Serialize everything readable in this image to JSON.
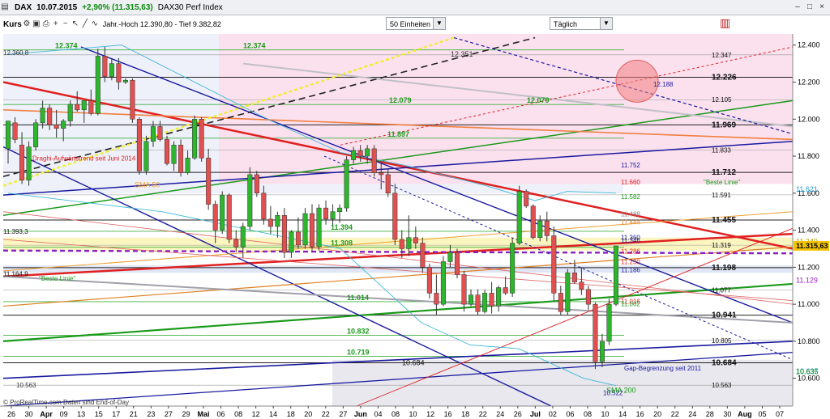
{
  "header": {
    "symbol": "DAX",
    "date": "10.07.2015",
    "change": "+2,90% (11.315,63)",
    "index_name": "DAX30 Perf Index"
  },
  "toolbar": {
    "kurs_label": "Kurs",
    "info": "Jahr.-Hoch 12.390,80 - Tief 9.382,82",
    "units_select": "50 Einheiten",
    "period_select": "Täglich"
  },
  "footer": {
    "credit": "© ProRealTime.com  Daten sind End-of-Day"
  },
  "icons": [
    "gear-icon",
    "save-icon",
    "print-icon",
    "zoom-in-icon",
    "zoom-out-icon",
    "cursor-icon",
    "line-tool-icon",
    "indicator-icon"
  ],
  "colors": {
    "up": "#2db52d",
    "down": "#e05050",
    "support": "#1a1aa0",
    "resistance": "#e02020"
  },
  "chart_data": {
    "type": "candlestick",
    "title": "DAX30 Perf Index",
    "ylim": [
      10450,
      12460
    ],
    "x_ticks": [
      "26",
      "30",
      "Apr",
      "09",
      "13",
      "15",
      "17",
      "21",
      "23",
      "27",
      "29",
      "Mai",
      "06",
      "08",
      "12",
      "14",
      "18",
      "20",
      "22",
      "27",
      "Jun",
      "04",
      "08",
      "10",
      "12",
      "16",
      "18",
      "22",
      "24",
      "26",
      "Jul",
      "02",
      "06",
      "08",
      "10",
      "14",
      "16",
      "20",
      "22",
      "24",
      "28",
      "30",
      "Aug",
      "05",
      "07"
    ],
    "y_ticks": [
      "12.400",
      "12.200",
      "12.000",
      "11.800",
      "11.600",
      "11.400",
      "11.200",
      "11.000",
      "10.800",
      "10.600"
    ],
    "price_labels_right": [
      {
        "text": "12.347",
        "value": 12347,
        "bold": false
      },
      {
        "text": "12.226",
        "value": 12226,
        "bold": true
      },
      {
        "text": "12.105",
        "value": 12105,
        "bold": false
      },
      {
        "text": "11.969",
        "value": 11969,
        "bold": true
      },
      {
        "text": "11.833",
        "value": 11833,
        "bold": false
      },
      {
        "text": "11.712",
        "value": 11712,
        "bold": true
      },
      {
        "text": "11.591",
        "value": 11591,
        "bold": false
      },
      {
        "text": "11.455",
        "value": 11455,
        "bold": true
      },
      {
        "text": "11.319",
        "value": 11319,
        "bold": false
      },
      {
        "text": "11.198",
        "value": 11198,
        "bold": true
      },
      {
        "text": "11.077",
        "value": 11077,
        "bold": false
      },
      {
        "text": "10.941",
        "value": 10941,
        "bold": true
      },
      {
        "text": "10.805",
        "value": 10805,
        "bold": false
      },
      {
        "text": "10.684",
        "value": 10684,
        "bold": true
      },
      {
        "text": "10.563",
        "value": 10563,
        "bold": false
      }
    ],
    "axis_badges": [
      {
        "text": "11.621",
        "value": 11621,
        "color": "#1a9ad8"
      },
      {
        "text": "11.340",
        "value": 11340,
        "color": "#b8a000"
      },
      {
        "text": "11.315,63",
        "value": 11315.63,
        "color": "#000000",
        "bg": "#f5c400"
      },
      {
        "text": "11.129",
        "value": 11129,
        "color": "#9a20c0"
      },
      {
        "text": "10.637",
        "value": 10637,
        "color": "#1a9ad8"
      },
      {
        "text": "10.635",
        "value": 10635,
        "color": "#0a8a0a"
      }
    ],
    "green_labels": [
      {
        "text": "12.374",
        "value": 12374,
        "pos": "left"
      },
      {
        "text": "12.374",
        "value": 12374,
        "pos": "mid"
      },
      {
        "text": "12.079",
        "value": 12079,
        "pos": "mid2"
      },
      {
        "text": "12.079",
        "value": 12079,
        "pos": "right"
      },
      {
        "text": "11.897",
        "value": 11897,
        "pos": "mid3"
      },
      {
        "text": "11.394",
        "value": 11394,
        "pos": "mid4"
      },
      {
        "text": "11.308",
        "value": 11308,
        "pos": "mid4"
      },
      {
        "text": "11.014",
        "value": 11014,
        "pos": "mid5"
      },
      {
        "text": "10.832",
        "value": 10832,
        "pos": "mid6"
      },
      {
        "text": "10.719",
        "value": 10719,
        "pos": "mid6"
      }
    ],
    "annotations": [
      {
        "text": "12.351",
        "value": 12351
      },
      {
        "text": "12.360,8",
        "value": 12360
      },
      {
        "text": "11.393,3",
        "value": 11393
      },
      {
        "text": "11.164,9",
        "value": 11164
      },
      {
        "text": "10.684",
        "value": 10684
      },
      {
        "text": "10.563",
        "value": 10563
      },
      {
        "text": "12.188",
        "value": 12188
      },
      {
        "text": "11.752",
        "value": 11752
      },
      {
        "text": "11.360",
        "value": 11360
      },
      {
        "text": "11.346",
        "value": 11346
      },
      {
        "text": "11.286",
        "value": 11286
      },
      {
        "text": "11.230",
        "value": 11230
      },
      {
        "text": "11.186",
        "value": 11186
      },
      {
        "text": "11.016",
        "value": 11016
      },
      {
        "text": "11.002",
        "value": 11002
      },
      {
        "text": "10.522",
        "value": 10522
      },
      {
        "text": "11.660",
        "value": 11660
      },
      {
        "text": "11.582",
        "value": 11582
      },
      {
        "text": "11.488",
        "value": 11488
      },
      {
        "text": "11.444",
        "value": 11444
      },
      {
        "text": "Draghi-Aufwärtstrend seit Juni 2014",
        "value": 11790
      },
      {
        "text": "SMA 50",
        "value": 11645
      },
      {
        "text": "\"Beste Linie\"",
        "value": 11140
      },
      {
        "text": "\"Beste Linie\"",
        "value": 11660
      },
      {
        "text": "Gap-Begrenzung seit 2011",
        "value": 10655
      },
      {
        "text": "SMA 200",
        "value": 10535
      }
    ],
    "candles": [
      {
        "o": 11840,
        "h": 11920,
        "l": 11760,
        "c": 11990
      },
      {
        "o": 11980,
        "h": 12010,
        "l": 11870,
        "c": 11890
      },
      {
        "o": 11860,
        "h": 11930,
        "l": 11650,
        "c": 11670
      },
      {
        "o": 11670,
        "h": 11880,
        "l": 11640,
        "c": 11850
      },
      {
        "o": 11850,
        "h": 12000,
        "l": 11830,
        "c": 11980
      },
      {
        "o": 11980,
        "h": 12100,
        "l": 11950,
        "c": 12060
      },
      {
        "o": 12060,
        "h": 12080,
        "l": 11940,
        "c": 11970
      },
      {
        "o": 11970,
        "h": 12050,
        "l": 11900,
        "c": 11950
      },
      {
        "o": 11950,
        "h": 12000,
        "l": 11880,
        "c": 11990
      },
      {
        "o": 11990,
        "h": 12100,
        "l": 11960,
        "c": 12080
      },
      {
        "o": 12080,
        "h": 12150,
        "l": 12040,
        "c": 12050
      },
      {
        "o": 12050,
        "h": 12100,
        "l": 11980,
        "c": 12100
      },
      {
        "o": 12100,
        "h": 12160,
        "l": 12020,
        "c": 12030
      },
      {
        "o": 12030,
        "h": 12380,
        "l": 12020,
        "c": 12340
      },
      {
        "o": 12340,
        "h": 12390,
        "l": 12200,
        "c": 12230
      },
      {
        "o": 12230,
        "h": 12330,
        "l": 12210,
        "c": 12300
      },
      {
        "o": 12300,
        "h": 12330,
        "l": 12160,
        "c": 12200
      },
      {
        "o": 12200,
        "h": 12220,
        "l": 12190,
        "c": 12210
      },
      {
        "o": 12210,
        "h": 12220,
        "l": 11980,
        "c": 12000
      },
      {
        "o": 12000,
        "h": 12010,
        "l": 11700,
        "c": 11720
      },
      {
        "o": 11720,
        "h": 11910,
        "l": 11700,
        "c": 11880
      },
      {
        "o": 11880,
        "h": 11990,
        "l": 11850,
        "c": 11960
      },
      {
        "o": 11960,
        "h": 11990,
        "l": 11880,
        "c": 11890
      },
      {
        "o": 11890,
        "h": 11910,
        "l": 11750,
        "c": 11760
      },
      {
        "o": 11760,
        "h": 11880,
        "l": 11720,
        "c": 11860
      },
      {
        "o": 11860,
        "h": 11890,
        "l": 11690,
        "c": 11710
      },
      {
        "o": 11710,
        "h": 11830,
        "l": 11700,
        "c": 11790
      },
      {
        "o": 11790,
        "h": 12020,
        "l": 11780,
        "c": 12000
      },
      {
        "o": 12000,
        "h": 12010,
        "l": 11770,
        "c": 11790
      },
      {
        "o": 11790,
        "h": 11840,
        "l": 11510,
        "c": 11540
      },
      {
        "o": 11540,
        "h": 11560,
        "l": 11330,
        "c": 11400
      },
      {
        "o": 11400,
        "h": 11610,
        "l": 11380,
        "c": 11590
      },
      {
        "o": 11590,
        "h": 11600,
        "l": 11330,
        "c": 11350
      },
      {
        "o": 11350,
        "h": 11400,
        "l": 11280,
        "c": 11310
      },
      {
        "o": 11310,
        "h": 11440,
        "l": 11250,
        "c": 11420
      },
      {
        "o": 11420,
        "h": 11740,
        "l": 11400,
        "c": 11700
      },
      {
        "o": 11700,
        "h": 11720,
        "l": 11580,
        "c": 11600
      },
      {
        "o": 11600,
        "h": 11640,
        "l": 11430,
        "c": 11460
      },
      {
        "o": 11460,
        "h": 11530,
        "l": 11380,
        "c": 11420
      },
      {
        "o": 11420,
        "h": 11500,
        "l": 11360,
        "c": 11480
      },
      {
        "o": 11480,
        "h": 11520,
        "l": 11250,
        "c": 11280
      },
      {
        "o": 11280,
        "h": 11400,
        "l": 11250,
        "c": 11390
      },
      {
        "o": 11390,
        "h": 11470,
        "l": 11300,
        "c": 11320
      },
      {
        "o": 11320,
        "h": 11520,
        "l": 11300,
        "c": 11490
      },
      {
        "o": 11490,
        "h": 11540,
        "l": 11290,
        "c": 11310
      },
      {
        "o": 11310,
        "h": 11540,
        "l": 11290,
        "c": 11520
      },
      {
        "o": 11520,
        "h": 11560,
        "l": 11430,
        "c": 11460
      },
      {
        "o": 11460,
        "h": 11540,
        "l": 11420,
        "c": 11500
      },
      {
        "o": 11500,
        "h": 11540,
        "l": 11440,
        "c": 11520
      },
      {
        "o": 11520,
        "h": 11800,
        "l": 11500,
        "c": 11780
      },
      {
        "o": 11780,
        "h": 11850,
        "l": 11760,
        "c": 11830
      },
      {
        "o": 11830,
        "h": 11860,
        "l": 11770,
        "c": 11800
      },
      {
        "o": 11800,
        "h": 11860,
        "l": 11760,
        "c": 11840
      },
      {
        "o": 11840,
        "h": 11860,
        "l": 11690,
        "c": 11710
      },
      {
        "o": 11710,
        "h": 11760,
        "l": 11620,
        "c": 11700
      },
      {
        "o": 11700,
        "h": 11730,
        "l": 11580,
        "c": 11600
      },
      {
        "o": 11600,
        "h": 11650,
        "l": 11320,
        "c": 11350
      },
      {
        "o": 11350,
        "h": 11400,
        "l": 11250,
        "c": 11300
      },
      {
        "o": 11300,
        "h": 11480,
        "l": 11260,
        "c": 11360
      },
      {
        "o": 11360,
        "h": 11420,
        "l": 11300,
        "c": 11330
      },
      {
        "o": 11330,
        "h": 11360,
        "l": 11170,
        "c": 11200
      },
      {
        "o": 11200,
        "h": 11220,
        "l": 11030,
        "c": 11060
      },
      {
        "o": 11060,
        "h": 11160,
        "l": 10940,
        "c": 11000
      },
      {
        "o": 11000,
        "h": 11260,
        "l": 10990,
        "c": 11230
      },
      {
        "o": 11230,
        "h": 11320,
        "l": 11200,
        "c": 11280
      },
      {
        "o": 11280,
        "h": 11300,
        "l": 11140,
        "c": 11160
      },
      {
        "o": 11160,
        "h": 11180,
        "l": 10960,
        "c": 11000
      },
      {
        "o": 11000,
        "h": 11080,
        "l": 10990,
        "c": 11050
      },
      {
        "o": 11050,
        "h": 11080,
        "l": 10940,
        "c": 10960
      },
      {
        "o": 10960,
        "h": 11080,
        "l": 10950,
        "c": 11060
      },
      {
        "o": 11060,
        "h": 11120,
        "l": 10950,
        "c": 10990
      },
      {
        "o": 10990,
        "h": 11100,
        "l": 10960,
        "c": 11090
      },
      {
        "o": 11090,
        "h": 11150,
        "l": 11050,
        "c": 11060
      },
      {
        "o": 11060,
        "h": 11360,
        "l": 11040,
        "c": 11330
      },
      {
        "o": 11330,
        "h": 11640,
        "l": 11320,
        "c": 11610
      },
      {
        "o": 11610,
        "h": 11620,
        "l": 11520,
        "c": 11530
      },
      {
        "o": 11530,
        "h": 11540,
        "l": 11350,
        "c": 11360
      },
      {
        "o": 11360,
        "h": 11480,
        "l": 11340,
        "c": 11450
      },
      {
        "o": 11450,
        "h": 11500,
        "l": 11340,
        "c": 11370
      },
      {
        "o": 11370,
        "h": 11420,
        "l": 11020,
        "c": 11060
      },
      {
        "o": 11060,
        "h": 11100,
        "l": 10940,
        "c": 10960
      },
      {
        "o": 10960,
        "h": 11190,
        "l": 10940,
        "c": 11170
      },
      {
        "o": 11170,
        "h": 11240,
        "l": 11110,
        "c": 11120
      },
      {
        "o": 11120,
        "h": 11200,
        "l": 11050,
        "c": 11080
      },
      {
        "o": 11080,
        "h": 11100,
        "l": 10970,
        "c": 11000
      },
      {
        "o": 11000,
        "h": 11010,
        "l": 10650,
        "c": 10690
      },
      {
        "o": 10690,
        "h": 10840,
        "l": 10660,
        "c": 10800
      },
      {
        "o": 10800,
        "h": 11030,
        "l": 10780,
        "c": 11000
      },
      {
        "o": 11000,
        "h": 11310,
        "l": 10990,
        "c": 11315
      }
    ]
  }
}
